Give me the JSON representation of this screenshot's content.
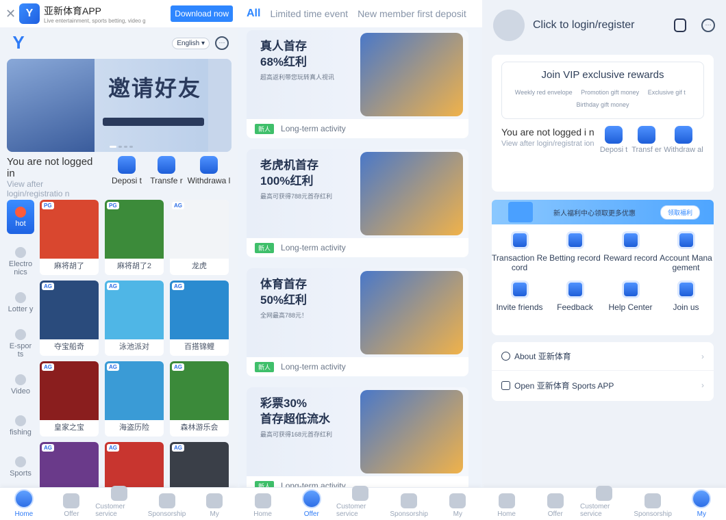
{
  "home": {
    "download_bar": {
      "close": "✕",
      "app_name": "亚新体育APP",
      "tagline": "Live entertainment, sports betting, video g",
      "download_label": "Download now"
    },
    "language": "English ▾",
    "banner_title": "邀请好友",
    "login": {
      "title": "You are not logged in",
      "subtitle": "View after login/registratio n"
    },
    "quick_actions": [
      {
        "label": "Deposi t"
      },
      {
        "label": "Transfe r"
      },
      {
        "label": "Withdrawa l"
      }
    ],
    "categories": [
      {
        "label": "hot"
      },
      {
        "label": "Electro nics"
      },
      {
        "label": "Lotter y"
      },
      {
        "label": "E-spor ts"
      },
      {
        "label": "Video"
      },
      {
        "label": "fishing"
      },
      {
        "label": "Sports"
      }
    ],
    "games": [
      {
        "name": "麻将胡了",
        "tag": "PG",
        "color": "#d9472f"
      },
      {
        "name": "麻将胡了2",
        "tag": "PG",
        "color": "#3c8b3a"
      },
      {
        "name": "龙虎",
        "tag": "AG",
        "color": "#f2f4f7"
      },
      {
        "name": "夺宝船奇",
        "tag": "AG",
        "color": "#2a4b7c"
      },
      {
        "name": "泳池派对",
        "tag": "AG",
        "color": "#4fb6e6"
      },
      {
        "name": "百搭锦鲤",
        "tag": "AG",
        "color": "#2b8bd0"
      },
      {
        "name": "皇家之宝",
        "tag": "AG",
        "color": "#8a1e1e"
      },
      {
        "name": "海盗历险",
        "tag": "AG",
        "color": "#3a9bd6"
      },
      {
        "name": "森林游乐会",
        "tag": "AG",
        "color": "#3b8a3a"
      },
      {
        "name": "",
        "tag": "AG",
        "color": "#6a3a8a"
      },
      {
        "name": "",
        "tag": "AG",
        "color": "#c8352f"
      },
      {
        "name": "",
        "tag": "AG",
        "color": "#3a3f48"
      }
    ],
    "nav": [
      {
        "label": "Home",
        "active": true
      },
      {
        "label": "Offer",
        "active": false
      },
      {
        "label": "Customer service",
        "active": false
      },
      {
        "label": "Sponsorship",
        "active": false
      },
      {
        "label": "My",
        "active": false
      }
    ]
  },
  "offers": {
    "filters": [
      {
        "label": "All",
        "active": true
      },
      {
        "label": "Limited time event",
        "active": false
      },
      {
        "label": "New member first deposit",
        "active": false
      }
    ],
    "promos": [
      {
        "title_line1": "真人首存",
        "title_line2": "68%红利",
        "subtitle": "超高返利带您玩转真人视讯",
        "badge": "新人",
        "footer": "Long-term activity"
      },
      {
        "title_line1": "老虎机首存",
        "title_line2": "100%红利",
        "subtitle": "最高可获得788元首存红利",
        "badge": "新人",
        "footer": "Long-term activity"
      },
      {
        "title_line1": "体育首存",
        "title_line2": "50%红利",
        "subtitle": "全网最高788元！",
        "badge": "新人",
        "footer": "Long-term activity"
      },
      {
        "title_line1": "彩票30%",
        "title_line2": "首存超低流水",
        "subtitle": "最高可获得168元首存红利",
        "badge": "新人",
        "footer": "Long-term activity"
      }
    ],
    "nav": [
      {
        "label": "Home",
        "active": false
      },
      {
        "label": "Offer",
        "active": true
      },
      {
        "label": "Customer service",
        "active": false
      },
      {
        "label": "Sponsorship",
        "active": false
      },
      {
        "label": "My",
        "active": false
      }
    ]
  },
  "profile": {
    "login_prompt": "Click to login/register",
    "vip": {
      "title": "Join VIP exclusive rewards",
      "items": [
        "Weekly red envelope",
        "Promotion gift money",
        "Exclusive gif t",
        "Birthday gift money"
      ]
    },
    "login": {
      "title": "You are not logged i n",
      "subtitle": "View after login/registrat ion"
    },
    "quick_actions": [
      {
        "label": "Deposi t"
      },
      {
        "label": "Transf er"
      },
      {
        "label": "Withdraw al"
      }
    ],
    "welfare": {
      "text": "新人福利中心领取更多优惠",
      "button": "领取福利"
    },
    "services": [
      {
        "label": "Transaction Re cord"
      },
      {
        "label": "Betting record"
      },
      {
        "label": "Reward record"
      },
      {
        "label": "Account Mana gement"
      },
      {
        "label": "Invite friends"
      },
      {
        "label": "Feedback"
      },
      {
        "label": "Help Center"
      },
      {
        "label": "Join us"
      }
    ],
    "links": [
      {
        "label": "About 亚新体育"
      },
      {
        "label": "Open 亚新体育 Sports APP"
      }
    ],
    "nav": [
      {
        "label": "Home",
        "active": false
      },
      {
        "label": "Offer",
        "active": false
      },
      {
        "label": "Customer service",
        "active": false
      },
      {
        "label": "Sponsorship",
        "active": false
      },
      {
        "label": "My",
        "active": true
      }
    ]
  }
}
